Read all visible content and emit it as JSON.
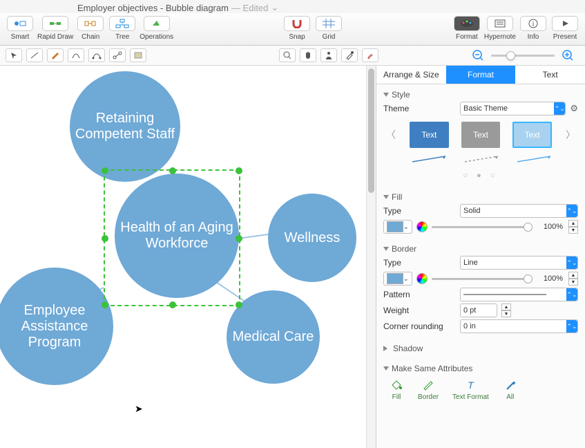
{
  "title": {
    "docname": "Employer objectives - Bubble diagram",
    "edited": "— Edited",
    "caret": "⌄"
  },
  "maintb": {
    "left": [
      {
        "name": "smart",
        "label": "Smart"
      },
      {
        "name": "rapid-draw",
        "label": "Rapid Draw"
      },
      {
        "name": "chain",
        "label": "Chain"
      },
      {
        "name": "tree",
        "label": "Tree"
      },
      {
        "name": "operations",
        "label": "Operations"
      }
    ],
    "center": [
      {
        "name": "snap",
        "label": "Snap"
      },
      {
        "name": "grid",
        "label": "Grid"
      }
    ],
    "right": [
      {
        "name": "format",
        "label": "Format"
      },
      {
        "name": "hypernote",
        "label": "Hypernote"
      },
      {
        "name": "info",
        "label": "Info"
      },
      {
        "name": "present",
        "label": "Present"
      }
    ]
  },
  "diagram": {
    "bubbles": {
      "center": "Health of an Aging Workforce",
      "top": "Retaining Competent Staff",
      "right": "Wellness",
      "bottomright": "Medical Care",
      "bottomleft": "Employee Assistance Program"
    }
  },
  "panel": {
    "tabs": {
      "arrange": "Arrange & Size",
      "format": "Format",
      "text": "Text"
    },
    "style": {
      "head": "Style",
      "theme_label": "Theme",
      "theme_value": "Basic Theme",
      "preset_text": "Text",
      "dots": "○ ● ○"
    },
    "fill": {
      "head": "Fill",
      "type_label": "Type",
      "type_value": "Solid",
      "pct": "100%"
    },
    "border": {
      "head": "Border",
      "type_label": "Type",
      "type_value": "Line",
      "pct": "100%",
      "pattern_label": "Pattern",
      "weight_label": "Weight",
      "weight_value": "0 pt",
      "corner_label": "Corner rounding",
      "corner_value": "0 in"
    },
    "shadow": {
      "head": "Shadow"
    },
    "makesame": {
      "head": "Make Same Attributes",
      "fill": "Fill",
      "border": "Border",
      "textformat": "Text Format",
      "all": "All"
    }
  }
}
